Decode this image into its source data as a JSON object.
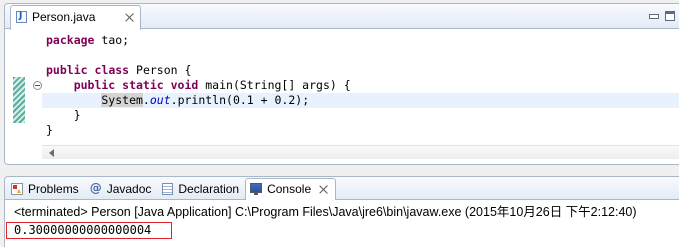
{
  "editor": {
    "tab": {
      "label": "Person.java",
      "icon": "java-file-icon"
    },
    "window_controls": [
      "minimize-icon",
      "maximize-icon"
    ],
    "lines": [
      {
        "tokens": [
          {
            "text": "package",
            "type": "keyword"
          },
          {
            "text": " tao;",
            "type": "plain"
          }
        ]
      },
      {
        "tokens": []
      },
      {
        "tokens": [
          {
            "text": "public",
            "type": "keyword"
          },
          {
            "text": " class",
            "type": "keyword"
          },
          {
            "text": " Person {",
            "type": "plain"
          }
        ]
      },
      {
        "tokens": [
          {
            "text": "public",
            "type": "keyword"
          },
          {
            "text": " static",
            "type": "keyword"
          },
          {
            "text": " void",
            "type": "keyword"
          },
          {
            "text": " main(String[] args) {",
            "type": "plain"
          }
        ]
      },
      {
        "tokens": [
          {
            "text": "System",
            "type": "occurrence"
          },
          {
            "text": ".",
            "type": "plain"
          },
          {
            "text": "out",
            "type": "static-field"
          },
          {
            "text": ".println(0.1 + 0.2);",
            "type": "plain"
          }
        ]
      },
      {
        "tokens": [
          {
            "text": "}",
            "type": "plain"
          }
        ]
      },
      {
        "tokens": [
          {
            "text": "}",
            "type": "plain"
          }
        ]
      }
    ]
  },
  "console_panel": {
    "tabs": [
      {
        "label": "Problems",
        "icon": "problems-icon"
      },
      {
        "label": "Javadoc",
        "icon": "javadoc-icon"
      },
      {
        "label": "Declaration",
        "icon": "declaration-icon"
      },
      {
        "label": "Console",
        "icon": "console-icon",
        "active": true
      }
    ],
    "header": "<terminated> Person [Java Application] C:\\Program Files\\Java\\jre6\\bin\\javaw.exe (2015年10月26日 下午2:12:40)",
    "output": "0.30000000000000004"
  },
  "colors": {
    "keyword": "#7F0055",
    "static_field": "#0000C0",
    "current_line": "#E8F2FE",
    "occurrence_highlight": "#D4D4D4",
    "annotation_box": "#E0242B",
    "change_marker": "#5BAE9E"
  }
}
